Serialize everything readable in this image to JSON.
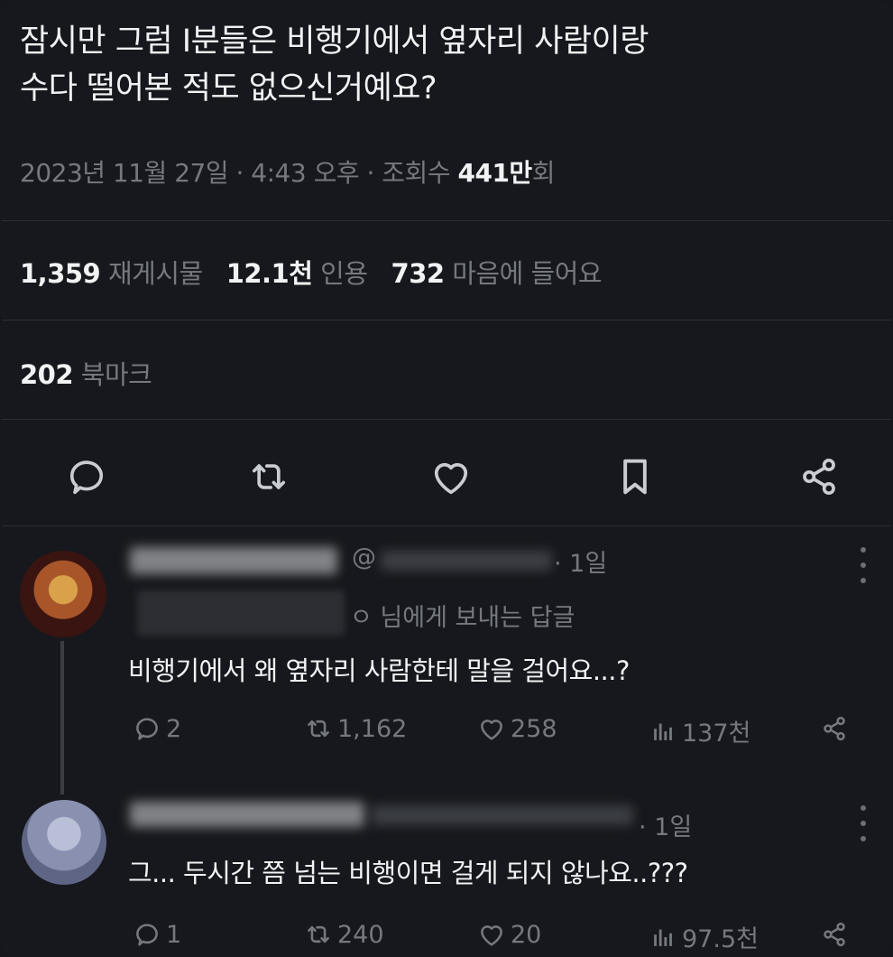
{
  "tweet": {
    "line1": "잠시만 그럼 I분들은 비행기에서 옆자리 사람이랑",
    "line2": "수다 떨어본 적도 없으신거예요?",
    "meta_date": "2023년 11월 27일 · 4:43 오후 · 조회수 ",
    "meta_views": "441만",
    "meta_suffix": "회"
  },
  "stats": {
    "retweets_num": "1,359",
    "retweets_label": "재게시물",
    "quotes_num": "12.1천",
    "quotes_label": "인용",
    "likes_num": "732",
    "likes_label": "마음에 들어요",
    "bookmarks_num": "202",
    "bookmarks_label": "북마크"
  },
  "actions": [
    "reply-icon",
    "retweet-icon",
    "heart-icon",
    "bookmark-icon",
    "share-icon"
  ],
  "replies": [
    {
      "handle_fragment": "@",
      "time": "· 1일",
      "replying_to_suffix": "ㅇ 님에게 보내는 답글",
      "text": "비행기에서 왜 옆자리 사람한테 말을 걸어요...?",
      "reply_count": "2",
      "retweet_count": "1,162",
      "like_count": "258",
      "view_count": "137천"
    },
    {
      "time": "· 1일",
      "text": "그... 두시간 쯤 넘는 비행이면 걸게 되지 않나요..???",
      "reply_count": "1",
      "retweet_count": "240",
      "like_count": "20",
      "view_count": "97.5천"
    }
  ],
  "colors": {
    "background": "#16181d",
    "text": "#f1f2f3",
    "muted": "#75797e",
    "icon": "#c9ccd0"
  }
}
